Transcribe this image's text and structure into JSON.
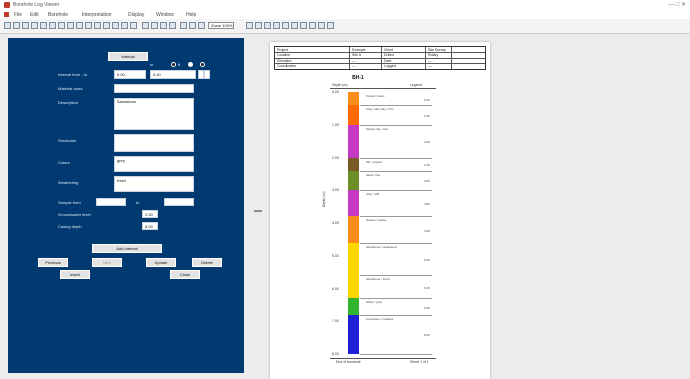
{
  "window": {
    "title": "Borehole Log Viewer",
    "controls": "— □ ✕"
  },
  "menu": [
    "File",
    "Edit",
    "Borehole",
    "Interpretation",
    "Display",
    "Window",
    "Help"
  ],
  "toolbar": {
    "zoom": "Zoom 100%"
  },
  "form": {
    "top_button": "Interval",
    "radio_labels": [
      "m",
      "ft"
    ],
    "fields": [
      {
        "label": "Interval from - to",
        "value": "0.00",
        "value2": "0.40"
      },
      {
        "label": "Material class",
        "value": ""
      },
      {
        "label": "Description",
        "value": "Sandstone"
      },
      {
        "label": "Structures",
        "value": ""
      },
      {
        "label": "Colour",
        "value": "grey"
      },
      {
        "label": "Weathering",
        "value": "fresh"
      }
    ],
    "sample_from_label": "Sample from",
    "sample_to_label": "to",
    "depth_row_1": {
      "label": "Groundwater level",
      "value": "2.50"
    },
    "depth_row_2": {
      "label": "Casing depth",
      "value": "6.00"
    },
    "buttons": {
      "add": "Add Interval",
      "previous": "Previous",
      "next": "Next",
      "update": "Update",
      "delete": "Delete",
      "insert": "Insert",
      "close": "Close"
    }
  },
  "report": {
    "header": [
      [
        "Project",
        "Example",
        "Client",
        "Site Survey"
      ],
      [
        "Location",
        "Site A",
        "Drilled",
        "Rotary"
      ],
      [
        "Elevation",
        "—",
        "Date",
        "—"
      ],
      [
        "Coordinates",
        "—",
        "Logged",
        "—"
      ]
    ],
    "log_title": "BH-1",
    "log_subtitle_left": "Depth (m)",
    "log_subtitle_right": "Legend",
    "depth_labels": [
      "0.00",
      "1.00",
      "2.00",
      "3.00",
      "4.00",
      "5.00",
      "6.00",
      "7.00",
      "8.00"
    ],
    "side_label": "Depth (m)",
    "layers": [
      {
        "color": "#ff8c1a",
        "desc": [
          "Topsoil",
          "loam"
        ],
        "val": "0.40"
      },
      {
        "color": "#ff6a00",
        "desc": [
          "Clay",
          "silty clay",
          "firm"
        ],
        "val": "1.00"
      },
      {
        "color": "#c438c4",
        "desc": [
          "Sandy clay",
          "wet"
        ],
        "val": "2.00"
      },
      {
        "color": "#7a5a24",
        "desc": [
          "Silt",
          "organic"
        ],
        "val": "2.40"
      },
      {
        "color": "#6b8f24",
        "desc": [
          "Sand",
          "fine"
        ],
        "val": "3.00"
      },
      {
        "color": "#c438c4",
        "desc": [
          "Clay",
          "stiff"
        ],
        "val": "3.80"
      },
      {
        "color": "#ff8c1a",
        "desc": [
          "Gravel",
          "coarse"
        ],
        "val": "4.60"
      },
      {
        "color": "#ffd700",
        "desc": [
          "Sandstone",
          "weathered"
        ],
        "val": "5.60"
      },
      {
        "color": "#ffd700",
        "desc": [
          "Sandstone",
          "fresh"
        ],
        "val": "6.30"
      },
      {
        "color": "#31b531",
        "desc": [
          "Shale",
          "grey"
        ],
        "val": "6.80"
      },
      {
        "color": "#1f1fd6",
        "desc": [
          "Limestone",
          "massive"
        ],
        "val": "8.00"
      }
    ],
    "footer_left": "End of borehole",
    "footer_right": "Sheet 1 of 1"
  }
}
